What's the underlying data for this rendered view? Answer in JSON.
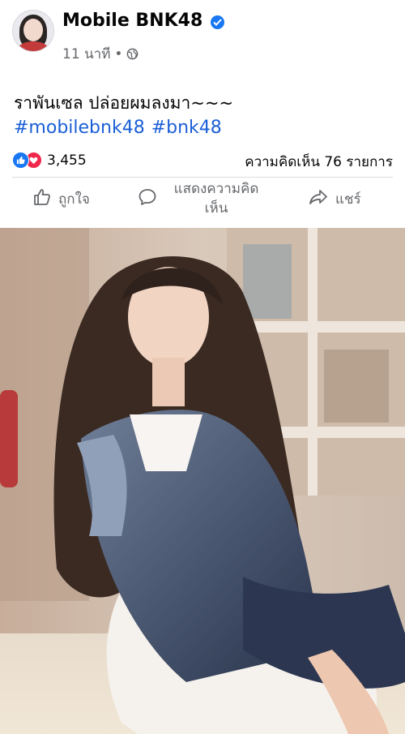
{
  "post": {
    "page_name": "Mobile BNK48",
    "time": "11 นาที",
    "dot": "•",
    "caption": "ราพันเซล ปล่อยผมลงมา~~~",
    "hashtags": [
      "#mobilebnk48",
      "#bnk48"
    ]
  },
  "stats": {
    "reaction_count": "3,455",
    "comments_label": "ความคิดเห็น 76 รายการ"
  },
  "actions": {
    "like": "ถูกใจ",
    "comment": "แสดงความคิดเห็น",
    "share": "แชร์"
  },
  "colors": {
    "link": "#1b5fd6",
    "verified": "#1877f2",
    "like_reaction": "#1877f2",
    "love_reaction": "#f0284a",
    "secondary_text": "#65676b"
  },
  "icons": [
    "avatar",
    "verified-badge-icon",
    "globe-icon",
    "like-reaction-icon",
    "love-reaction-icon",
    "thumbs-up-icon",
    "comment-bubble-icon",
    "share-arrow-icon"
  ]
}
